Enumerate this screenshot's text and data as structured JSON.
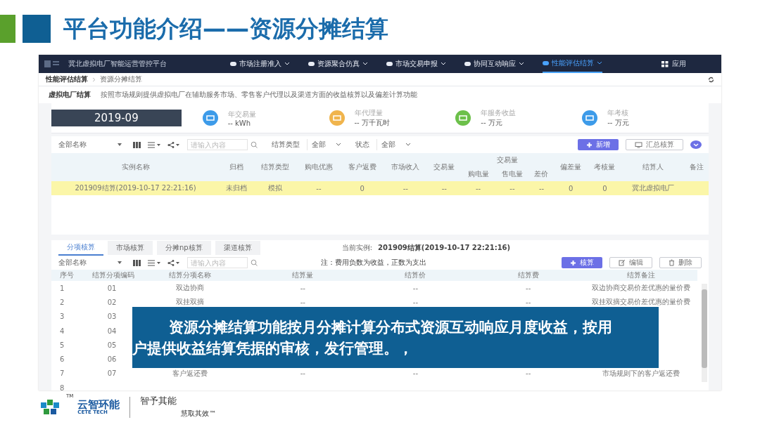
{
  "slide": {
    "title": "平台功能介绍——资源分摊结算"
  },
  "app": {
    "brand": "冀北虚拟电厂智能运营管控平台",
    "nav": [
      {
        "label": "市场注册准入",
        "selected": false
      },
      {
        "label": "资源聚合仿真",
        "selected": false
      },
      {
        "label": "市场交易申报",
        "selected": false
      },
      {
        "label": "协同互动响应",
        "selected": false
      },
      {
        "label": "性能评估结算",
        "selected": true
      }
    ],
    "apps_label": "应用",
    "breadcrumb": [
      "性能评估结算",
      "资源分摊结算"
    ],
    "section": {
      "title": "虚拟电厂结算",
      "description": "按照市场规则提供虚拟电厂在辅助服务市场、零售客户代理以及渠道方面的收益核算以及偏差计算功能"
    },
    "period": "2019-09",
    "stats": [
      {
        "label": "年交易量",
        "value": "-- kWh",
        "color": "#3d9be9"
      },
      {
        "label": "年代理量",
        "value": "-- 万千瓦时",
        "color": "#f0b44c"
      },
      {
        "label": "年服务收益",
        "value": "-- 万元",
        "color": "#6cc04a"
      },
      {
        "label": "年考核",
        "value": "-- 万元",
        "color": "#3d9be9"
      }
    ],
    "toolbar": {
      "name_select": "全部名称",
      "search_placeholder": "请输入内容",
      "filters": [
        {
          "label": "结算类型",
          "value": "全部"
        },
        {
          "label": "状态",
          "value": "全部"
        }
      ],
      "buttons": [
        {
          "label": "新增",
          "kind": "add"
        },
        {
          "label": "汇总核算",
          "kind": "summary"
        }
      ]
    },
    "instances": {
      "columns": [
        {
          "label": "实例名称"
        },
        {
          "label": "归档"
        },
        {
          "label": "结算类型"
        },
        {
          "label": "购电优惠"
        },
        {
          "label": "客户返费"
        },
        {
          "label": "市场收入"
        },
        {
          "label": "交易量"
        },
        {
          "label": "交易量",
          "colspan": 3,
          "children": [
            {
              "label": "购电量"
            },
            {
              "label": "售电量"
            },
            {
              "label": "差价"
            }
          ]
        },
        {
          "label": "偏差量"
        },
        {
          "label": "考核量"
        },
        {
          "label": "结算人"
        },
        {
          "label": "备注"
        }
      ],
      "rows": [
        {
          "selected": true,
          "cells": [
            "201909结算(2019-10-17 22:21:16)",
            "未归档",
            "模拟",
            "--",
            "0",
            "--",
            "--",
            "--",
            "--",
            "--",
            "0",
            "0",
            "冀北虚拟电厂"
          ]
        }
      ]
    },
    "detail": {
      "tabs": [
        {
          "label": "分项核算",
          "selected": true
        },
        {
          "label": "市场核算",
          "selected": false
        },
        {
          "label": "分摊np核算",
          "selected": false
        },
        {
          "label": "渠道核算",
          "selected": false
        }
      ],
      "current_label": "当前实例:",
      "current_value": "201909结算(2019-10-17 22:21:16)",
      "name_select": "全部名称",
      "search_placeholder": "请输入内容",
      "note": "注：费用负数为收益，正数为支出",
      "buttons": [
        {
          "label": "核算",
          "kind": "add"
        },
        {
          "label": "编辑",
          "kind": "edit"
        },
        {
          "label": "删除",
          "kind": "delete"
        }
      ],
      "columns": [
        "序号",
        "结算分项编码",
        "结算分项名称",
        "结算量",
        "结算价",
        "结算费",
        "结算备注"
      ],
      "rows": [
        [
          "1",
          "01",
          "双边协商",
          "--",
          "--",
          "--",
          "双边协商交易价差优惠的量价费"
        ],
        [
          "2",
          "02",
          "双挂双摘",
          "--",
          "--",
          "--",
          "双挂双摘交易价差优惠的量价费"
        ],
        [
          "3",
          "03"
        ],
        [
          "4",
          "04"
        ],
        [
          "5",
          "05"
        ],
        [
          "6",
          "06"
        ],
        [
          "7",
          "07",
          "客户返还费",
          "--",
          "--",
          "--",
          "市场规则下的客户返还费"
        ],
        [
          "8"
        ]
      ]
    }
  },
  "caption": "资源分摊结算功能按月分摊计算分布式资源互动响应月度收益，按用户提供收益结算凭据的审核，发行管理。，",
  "footer": {
    "tm": "TM",
    "name": "云智环能",
    "sub": "CETE TECH",
    "slogan": "智予其能",
    "tagline": "慧取其效™"
  }
}
